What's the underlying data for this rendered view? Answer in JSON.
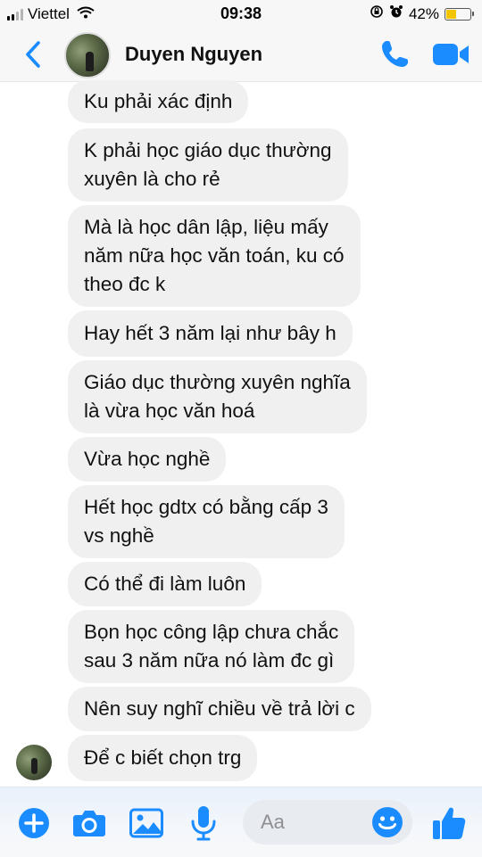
{
  "status_bar": {
    "carrier": "Viettel",
    "time": "09:38",
    "battery_percent": "42%",
    "battery_level": 0.42,
    "signal_bars": 4,
    "signal_active": 2
  },
  "header": {
    "contact_name": "Duyen Nguyen",
    "accent_color": "#1a8cff"
  },
  "messages": [
    {
      "text": "Ku phải xác định"
    },
    {
      "text": "K phải học giáo dục thường\nxuyên là cho rẻ"
    },
    {
      "text": "Mà là học dân lập, liệu mấy\nnăm nữa học văn toán, ku có\ntheo đc k"
    },
    {
      "text": "Hay hết 3 năm lại như bây h"
    },
    {
      "text": "Giáo dục thường xuyên nghĩa\nlà vừa học văn hoá"
    },
    {
      "text": "Vừa học nghề"
    },
    {
      "text": "Hết học gdtx có bằng cấp 3\nvs nghề"
    },
    {
      "text": "Có thể đi làm luôn"
    },
    {
      "text": "Bọn học công lập chưa chắc\nsau 3 năm nữa nó làm đc gì"
    },
    {
      "text": "Nên suy nghĩ chiều về trả lời c"
    },
    {
      "text": "Để c biết chọn trg"
    }
  ],
  "composer": {
    "placeholder": "Aa"
  },
  "icons": {
    "back": "chevron-left-icon",
    "call": "phone-icon",
    "video": "video-camera-icon",
    "plus": "plus-circle-icon",
    "camera": "camera-icon",
    "gallery": "image-icon",
    "mic": "microphone-icon",
    "emoji": "smiley-icon",
    "like": "thumbs-up-icon"
  }
}
